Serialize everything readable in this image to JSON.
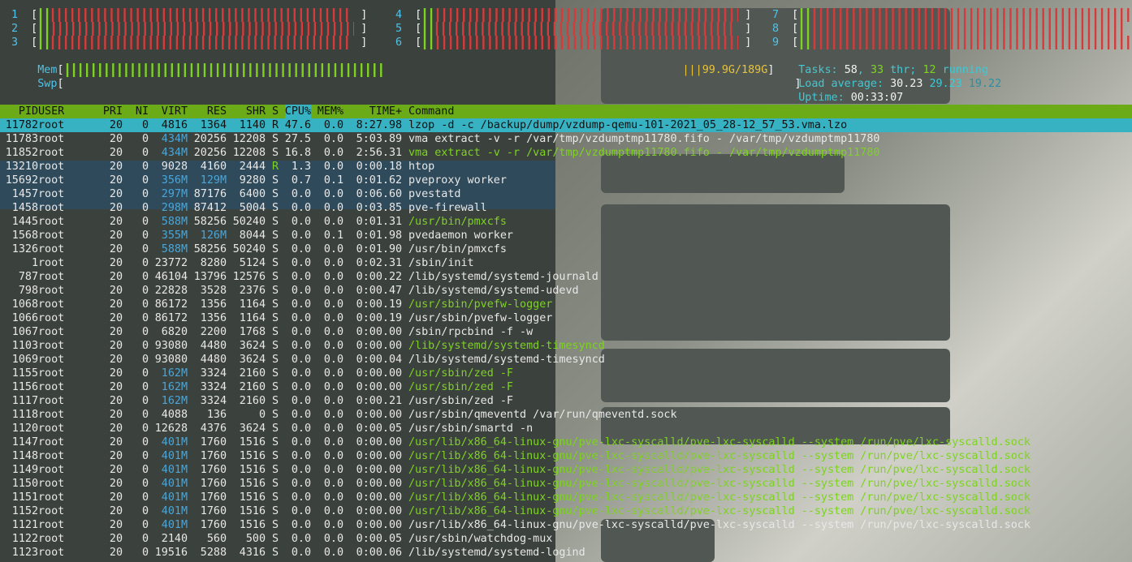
{
  "meters": {
    "cpus": [
      {
        "num": "1",
        "level": 0.97
      },
      {
        "num": "2",
        "level": 0.98
      },
      {
        "num": "3",
        "level": 0.97
      },
      {
        "num": "4",
        "level": 0.98
      },
      {
        "num": "5",
        "level": 0.97
      },
      {
        "num": "6",
        "level": 0.98
      },
      {
        "num": "7",
        "level": 0.98
      },
      {
        "num": "8",
        "level": 0.97
      },
      {
        "num": "9",
        "level": 0.98
      }
    ],
    "mem": {
      "label": "Mem",
      "value": "99.9G/189G",
      "level": 0.52
    },
    "swp": {
      "label": "Swp",
      "level": 0.0
    },
    "tasks": {
      "label": "Tasks:",
      "count": "58",
      "sep": ",",
      "threads": "33",
      "thr_label": "thr;",
      "running": "12",
      "running_label": "running"
    },
    "load": {
      "label": "Load average:",
      "one": "30.23",
      "five": "29.23",
      "fifteen": "19.22"
    },
    "uptime": {
      "label": "Uptime:",
      "value": "00:33:07"
    }
  },
  "table": {
    "columns": [
      "PID",
      "USER",
      "PRI",
      "NI",
      "VIRT",
      "RES",
      "SHR",
      "S",
      "CPU%",
      "MEM%",
      "TIME+",
      "Command"
    ],
    "rows": [
      {
        "pid": "11782",
        "user": "root",
        "pri": "20",
        "ni": "0",
        "virt": "4816",
        "res": "1364",
        "shr": "1140",
        "s": "R",
        "cpu": "47.6",
        "mem": "0.0",
        "time": "8:27.98",
        "cmd": "lzop -d -c /backup/dump/vzdump-qemu-101-2021_05_28-12_57_53.vma.lzo",
        "thread": false,
        "selected": true
      },
      {
        "pid": "11783",
        "user": "root",
        "pri": "20",
        "ni": "0",
        "virt": "434M",
        "res": "20256",
        "shr": "12208",
        "s": "S",
        "cpu": "27.5",
        "mem": "0.0",
        "time": "5:03.89",
        "cmd": "vma extract -v -r /var/tmp/vzdumptmp11780.fifo - /var/tmp/vzdumptmp11780",
        "thread": false
      },
      {
        "pid": "11852",
        "user": "root",
        "pri": "20",
        "ni": "0",
        "virt": "434M",
        "res": "20256",
        "shr": "12208",
        "s": "S",
        "cpu": "16.8",
        "mem": "0.0",
        "time": "2:56.31",
        "cmd": "vma extract -v -r /var/tmp/vzdumptmp11780.fifo - /var/tmp/vzdumptmp11780",
        "thread": true
      },
      {
        "pid": "13210",
        "user": "root",
        "pri": "20",
        "ni": "0",
        "virt": "9028",
        "res": "4160",
        "shr": "2444",
        "s": "R",
        "cpu": "1.3",
        "mem": "0.0",
        "time": "0:00.18",
        "cmd": "htop",
        "thread": false
      },
      {
        "pid": "15692",
        "user": "root",
        "pri": "20",
        "ni": "0",
        "virt": "356M",
        "res": "129M",
        "shr": "9280",
        "s": "S",
        "cpu": "0.7",
        "mem": "0.1",
        "time": "0:01.62",
        "cmd": "pveproxy worker",
        "thread": false
      },
      {
        "pid": "1457",
        "user": "root",
        "pri": "20",
        "ni": "0",
        "virt": "297M",
        "res": "87176",
        "shr": "6400",
        "s": "S",
        "cpu": "0.0",
        "mem": "0.0",
        "time": "0:06.60",
        "cmd": "pvestatd",
        "thread": false
      },
      {
        "pid": "1458",
        "user": "root",
        "pri": "20",
        "ni": "0",
        "virt": "298M",
        "res": "87412",
        "shr": "5004",
        "s": "S",
        "cpu": "0.0",
        "mem": "0.0",
        "time": "0:03.85",
        "cmd": "pve-firewall",
        "thread": false
      },
      {
        "pid": "1445",
        "user": "root",
        "pri": "20",
        "ni": "0",
        "virt": "588M",
        "res": "58256",
        "shr": "50240",
        "s": "S",
        "cpu": "0.0",
        "mem": "0.0",
        "time": "0:01.31",
        "cmd": "/usr/bin/pmxcfs",
        "thread": true
      },
      {
        "pid": "1568",
        "user": "root",
        "pri": "20",
        "ni": "0",
        "virt": "355M",
        "res": "126M",
        "shr": "8044",
        "s": "S",
        "cpu": "0.0",
        "mem": "0.1",
        "time": "0:01.98",
        "cmd": "pvedaemon worker",
        "thread": false
      },
      {
        "pid": "1326",
        "user": "root",
        "pri": "20",
        "ni": "0",
        "virt": "588M",
        "res": "58256",
        "shr": "50240",
        "s": "S",
        "cpu": "0.0",
        "mem": "0.0",
        "time": "0:01.90",
        "cmd": "/usr/bin/pmxcfs",
        "thread": false
      },
      {
        "pid": "1",
        "user": "root",
        "pri": "20",
        "ni": "0",
        "virt": "23772",
        "res": "8280",
        "shr": "5124",
        "s": "S",
        "cpu": "0.0",
        "mem": "0.0",
        "time": "0:02.31",
        "cmd": "/sbin/init",
        "thread": false
      },
      {
        "pid": "787",
        "user": "root",
        "pri": "20",
        "ni": "0",
        "virt": "46104",
        "res": "13796",
        "shr": "12576",
        "s": "S",
        "cpu": "0.0",
        "mem": "0.0",
        "time": "0:00.22",
        "cmd": "/lib/systemd/systemd-journald",
        "thread": false
      },
      {
        "pid": "798",
        "user": "root",
        "pri": "20",
        "ni": "0",
        "virt": "22828",
        "res": "3528",
        "shr": "2376",
        "s": "S",
        "cpu": "0.0",
        "mem": "0.0",
        "time": "0:00.47",
        "cmd": "/lib/systemd/systemd-udevd",
        "thread": false
      },
      {
        "pid": "1068",
        "user": "root",
        "pri": "20",
        "ni": "0",
        "virt": "86172",
        "res": "1356",
        "shr": "1164",
        "s": "S",
        "cpu": "0.0",
        "mem": "0.0",
        "time": "0:00.19",
        "cmd": "/usr/sbin/pvefw-logger",
        "thread": true
      },
      {
        "pid": "1066",
        "user": "root",
        "pri": "20",
        "ni": "0",
        "virt": "86172",
        "res": "1356",
        "shr": "1164",
        "s": "S",
        "cpu": "0.0",
        "mem": "0.0",
        "time": "0:00.19",
        "cmd": "/usr/sbin/pvefw-logger",
        "thread": false
      },
      {
        "pid": "1067",
        "user": "root",
        "pri": "20",
        "ni": "0",
        "virt": "6820",
        "res": "2200",
        "shr": "1768",
        "s": "S",
        "cpu": "0.0",
        "mem": "0.0",
        "time": "0:00.00",
        "cmd": "/sbin/rpcbind -f -w",
        "thread": false
      },
      {
        "pid": "1103",
        "user": "root",
        "pri": "20",
        "ni": "0",
        "virt": "93080",
        "res": "4480",
        "shr": "3624",
        "s": "S",
        "cpu": "0.0",
        "mem": "0.0",
        "time": "0:00.00",
        "cmd": "/lib/systemd/systemd-timesyncd",
        "thread": true
      },
      {
        "pid": "1069",
        "user": "root",
        "pri": "20",
        "ni": "0",
        "virt": "93080",
        "res": "4480",
        "shr": "3624",
        "s": "S",
        "cpu": "0.0",
        "mem": "0.0",
        "time": "0:00.04",
        "cmd": "/lib/systemd/systemd-timesyncd",
        "thread": false
      },
      {
        "pid": "1155",
        "user": "root",
        "pri": "20",
        "ni": "0",
        "virt": "162M",
        "res": "3324",
        "shr": "2160",
        "s": "S",
        "cpu": "0.0",
        "mem": "0.0",
        "time": "0:00.00",
        "cmd": "/usr/sbin/zed -F",
        "thread": true
      },
      {
        "pid": "1156",
        "user": "root",
        "pri": "20",
        "ni": "0",
        "virt": "162M",
        "res": "3324",
        "shr": "2160",
        "s": "S",
        "cpu": "0.0",
        "mem": "0.0",
        "time": "0:00.00",
        "cmd": "/usr/sbin/zed -F",
        "thread": true
      },
      {
        "pid": "1117",
        "user": "root",
        "pri": "20",
        "ni": "0",
        "virt": "162M",
        "res": "3324",
        "shr": "2160",
        "s": "S",
        "cpu": "0.0",
        "mem": "0.0",
        "time": "0:00.21",
        "cmd": "/usr/sbin/zed -F",
        "thread": false
      },
      {
        "pid": "1118",
        "user": "root",
        "pri": "20",
        "ni": "0",
        "virt": "4088",
        "res": "136",
        "shr": "0",
        "s": "S",
        "cpu": "0.0",
        "mem": "0.0",
        "time": "0:00.00",
        "cmd": "/usr/sbin/qmeventd /var/run/qmeventd.sock",
        "thread": false
      },
      {
        "pid": "1120",
        "user": "root",
        "pri": "20",
        "ni": "0",
        "virt": "12628",
        "res": "4376",
        "shr": "3624",
        "s": "S",
        "cpu": "0.0",
        "mem": "0.0",
        "time": "0:00.05",
        "cmd": "/usr/sbin/smartd -n",
        "thread": false
      },
      {
        "pid": "1147",
        "user": "root",
        "pri": "20",
        "ni": "0",
        "virt": "401M",
        "res": "1760",
        "shr": "1516",
        "s": "S",
        "cpu": "0.0",
        "mem": "0.0",
        "time": "0:00.00",
        "cmd": "/usr/lib/x86_64-linux-gnu/pve-lxc-syscalld/pve-lxc-syscalld --system /run/pve/lxc-syscalld.sock",
        "thread": true
      },
      {
        "pid": "1148",
        "user": "root",
        "pri": "20",
        "ni": "0",
        "virt": "401M",
        "res": "1760",
        "shr": "1516",
        "s": "S",
        "cpu": "0.0",
        "mem": "0.0",
        "time": "0:00.00",
        "cmd": "/usr/lib/x86_64-linux-gnu/pve-lxc-syscalld/pve-lxc-syscalld --system /run/pve/lxc-syscalld.sock",
        "thread": true
      },
      {
        "pid": "1149",
        "user": "root",
        "pri": "20",
        "ni": "0",
        "virt": "401M",
        "res": "1760",
        "shr": "1516",
        "s": "S",
        "cpu": "0.0",
        "mem": "0.0",
        "time": "0:00.00",
        "cmd": "/usr/lib/x86_64-linux-gnu/pve-lxc-syscalld/pve-lxc-syscalld --system /run/pve/lxc-syscalld.sock",
        "thread": true
      },
      {
        "pid": "1150",
        "user": "root",
        "pri": "20",
        "ni": "0",
        "virt": "401M",
        "res": "1760",
        "shr": "1516",
        "s": "S",
        "cpu": "0.0",
        "mem": "0.0",
        "time": "0:00.00",
        "cmd": "/usr/lib/x86_64-linux-gnu/pve-lxc-syscalld/pve-lxc-syscalld --system /run/pve/lxc-syscalld.sock",
        "thread": true
      },
      {
        "pid": "1151",
        "user": "root",
        "pri": "20",
        "ni": "0",
        "virt": "401M",
        "res": "1760",
        "shr": "1516",
        "s": "S",
        "cpu": "0.0",
        "mem": "0.0",
        "time": "0:00.00",
        "cmd": "/usr/lib/x86_64-linux-gnu/pve-lxc-syscalld/pve-lxc-syscalld --system /run/pve/lxc-syscalld.sock",
        "thread": true
      },
      {
        "pid": "1152",
        "user": "root",
        "pri": "20",
        "ni": "0",
        "virt": "401M",
        "res": "1760",
        "shr": "1516",
        "s": "S",
        "cpu": "0.0",
        "mem": "0.0",
        "time": "0:00.00",
        "cmd": "/usr/lib/x86_64-linux-gnu/pve-lxc-syscalld/pve-lxc-syscalld --system /run/pve/lxc-syscalld.sock",
        "thread": true
      },
      {
        "pid": "1121",
        "user": "root",
        "pri": "20",
        "ni": "0",
        "virt": "401M",
        "res": "1760",
        "shr": "1516",
        "s": "S",
        "cpu": "0.0",
        "mem": "0.0",
        "time": "0:00.00",
        "cmd": "/usr/lib/x86_64-linux-gnu/pve-lxc-syscalld/pve-lxc-syscalld --system /run/pve/lxc-syscalld.sock",
        "thread": false
      },
      {
        "pid": "1122",
        "user": "root",
        "pri": "20",
        "ni": "0",
        "virt": "2140",
        "res": "560",
        "shr": "500",
        "s": "S",
        "cpu": "0.0",
        "mem": "0.0",
        "time": "0:00.05",
        "cmd": "/usr/sbin/watchdog-mux",
        "thread": false
      },
      {
        "pid": "1123",
        "user": "root",
        "pri": "20",
        "ni": "0",
        "virt": "19516",
        "res": "5288",
        "shr": "4316",
        "s": "S",
        "cpu": "0.0",
        "mem": "0.0",
        "time": "0:00.06",
        "cmd": "/lib/systemd/systemd-logind",
        "thread": false
      }
    ]
  },
  "colors": {
    "header_bg": "#6bab17",
    "selected_bg": "#37b2c2",
    "thread_cmd": "#7ed321",
    "meter_green": "#7ed321",
    "meter_red": "#d63a3a",
    "label_cyan": "#3ec9d6"
  }
}
